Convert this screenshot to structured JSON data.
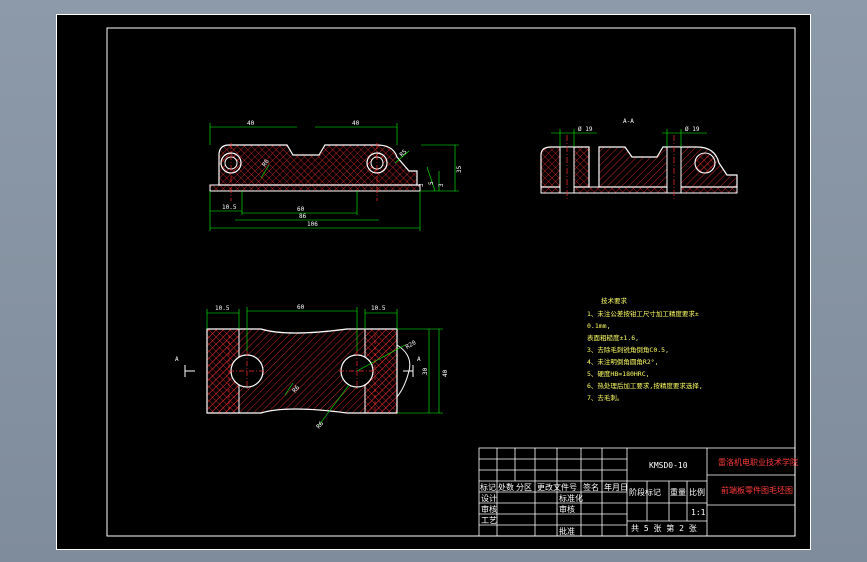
{
  "drawing": {
    "section_label": "A-A",
    "dims_front": [
      "40",
      "40",
      "R6",
      "R5",
      "10.5",
      "60",
      "86",
      "106",
      "3",
      "5",
      "3",
      "35"
    ],
    "dims_right": [
      "Ø 19",
      "Ø 19"
    ],
    "dims_top": [
      "10.5",
      "60",
      "10.5",
      "R20",
      "R6",
      "R6",
      "30",
      "40",
      "A",
      "A"
    ],
    "notes_title": "技术要求",
    "notes": [
      "1、未注公差按钳工尺寸加工精度要求±",
      "0.1mm,",
      "表面粗糙度±1.6,",
      "3、去除毛刺锐角倒角C0.5,",
      "4、未注明倒角圆角R2°,",
      "5、硬度HB=180HRC,",
      "6、热处理后加工要求,按精度要求选择,",
      "7、去毛刺。"
    ]
  },
  "title_block": {
    "drawing_no": "KMSD0-10",
    "school": "雷洛机电职业技术学院",
    "part_name": "前端板零件图毛坯图",
    "rows": {
      "change_header": [
        "标记",
        "处数",
        "分区",
        "更改文件号",
        "签名",
        "年月日"
      ],
      "design": "设计",
      "standardize": "标准化",
      "check": "审核",
      "process": "工艺",
      "approve": "批准",
      "review": "审核",
      "stage_mark": "阶段标记",
      "weight": "重量",
      "scale": "比例",
      "scale_value": "1:1",
      "sheet_info": "共 5 张 第 2 张"
    }
  }
}
